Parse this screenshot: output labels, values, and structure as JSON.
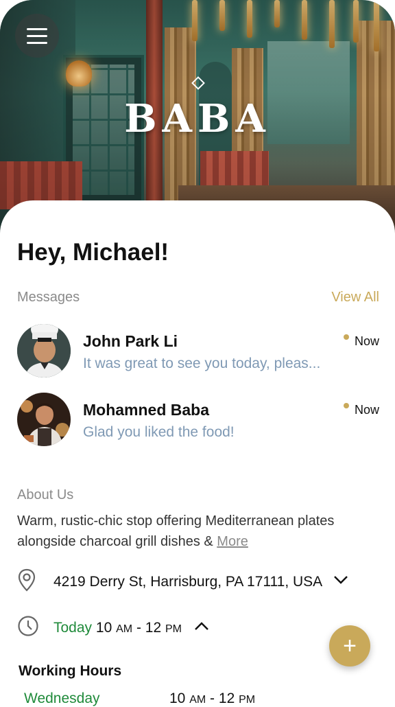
{
  "brand": {
    "logo_text": "BABA"
  },
  "greeting": "Hey, Michael!",
  "messages": {
    "label": "Messages",
    "view_all": "View All",
    "items": [
      {
        "name": "John Park Li",
        "preview": "It was great to see you today, pleas...",
        "time": "Now"
      },
      {
        "name": "Mohamned Baba",
        "preview": "Glad you liked the food!",
        "time": "Now"
      }
    ]
  },
  "about": {
    "label": "About Us",
    "text": "Warm, rustic-chic stop offering Mediterranean plates alongside charcoal grill dishes & ",
    "more": "More"
  },
  "address": "4219 Derry St, Harrisburg, PA 17111, USA",
  "hours_today": {
    "label": "Today",
    "open": "10",
    "open_suffix": "AM",
    "sep": "-",
    "close": "12",
    "close_suffix": "PM"
  },
  "working_hours": {
    "title": "Working Hours",
    "rows": [
      {
        "day": "Wednesday",
        "open": "10",
        "open_suffix": "AM",
        "close": "12",
        "close_suffix": "PM"
      }
    ]
  },
  "fab_symbol": "+",
  "colors": {
    "accent": "#c9a95a",
    "today_green": "#1f8a3a",
    "preview_blue": "#7f99b4"
  },
  "icons": [
    "menu-icon",
    "location-pin-icon",
    "clock-icon",
    "chevron-down-icon",
    "chevron-up-icon",
    "plus-icon"
  ]
}
